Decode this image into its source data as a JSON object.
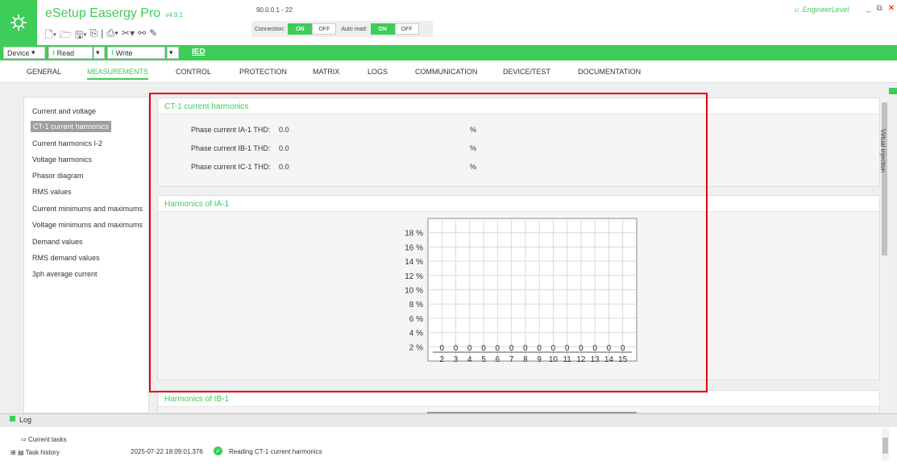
{
  "app": {
    "title": "eSetup Easergy Pro",
    "version": "v4.9.1",
    "ip": "90.0.0.1 - 22",
    "user_level": "EngineerLevel",
    "connection_label": "Connection:",
    "auto_read_label": "Auto read:",
    "on_label": "ON",
    "off_label": "OFF"
  },
  "toolbar": {
    "device": "Device",
    "read": "Read",
    "write": "Write",
    "ied": "IED"
  },
  "tabs": [
    "GENERAL",
    "MEASUREMENTS",
    "CONTROL",
    "PROTECTION",
    "MATRIX",
    "LOGS",
    "COMMUNICATION",
    "DEVICE/TEST",
    "DOCUMENTATION"
  ],
  "active_tab": "MEASUREMENTS",
  "sidebar": {
    "items": [
      "Current and voltage",
      "CT-1 current harmonics",
      "Current harmonics I-2",
      "Voltage harmonics",
      "Phasor diagram",
      "RMS values",
      "Current minimums and maximums",
      "Voltage minimums and maximums",
      "Demand values",
      "RMS demand values",
      "3ph average current"
    ],
    "active_index": 1
  },
  "thd_panel": {
    "title": "CT-1 current harmonics",
    "rows": [
      {
        "label": "Phase current IA-1 THD:",
        "value": "0.0",
        "unit": "%"
      },
      {
        "label": "Phase current IB-1 THD:",
        "value": "0.0",
        "unit": "%"
      },
      {
        "label": "Phase current IC-1 THD:",
        "value": "0.0",
        "unit": "%"
      }
    ]
  },
  "harmonics_ia": {
    "title": "Harmonics of IA-1"
  },
  "harmonics_ib": {
    "title": "Harmonics of IB-1"
  },
  "chart_data": {
    "type": "bar",
    "categories": [
      "2",
      "3",
      "4",
      "5",
      "6",
      "7",
      "8",
      "9",
      "10",
      "11",
      "12",
      "13",
      "14",
      "15"
    ],
    "values": [
      0,
      0,
      0,
      0,
      0,
      0,
      0,
      0,
      0,
      0,
      0,
      0,
      0,
      0
    ],
    "data_labels": [
      "0",
      "0",
      "0",
      "0",
      "0",
      "0",
      "0",
      "0",
      "0",
      "0",
      "0",
      "0",
      "0",
      "0"
    ],
    "y_ticks": [
      "2 %",
      "4 %",
      "6 %",
      "8 %",
      "10 %",
      "12 %",
      "14 %",
      "16 %",
      "18 %"
    ],
    "ylim": [
      0,
      20
    ],
    "grid": true
  },
  "virtual_injection": "Virtual injection",
  "log": {
    "title": "Log",
    "current_tasks": "Current tasks",
    "task_history": "Task history",
    "entry_time": "2025-07-22 18:09:01.376",
    "entry_text": "Reading CT-1 current harmonics"
  }
}
